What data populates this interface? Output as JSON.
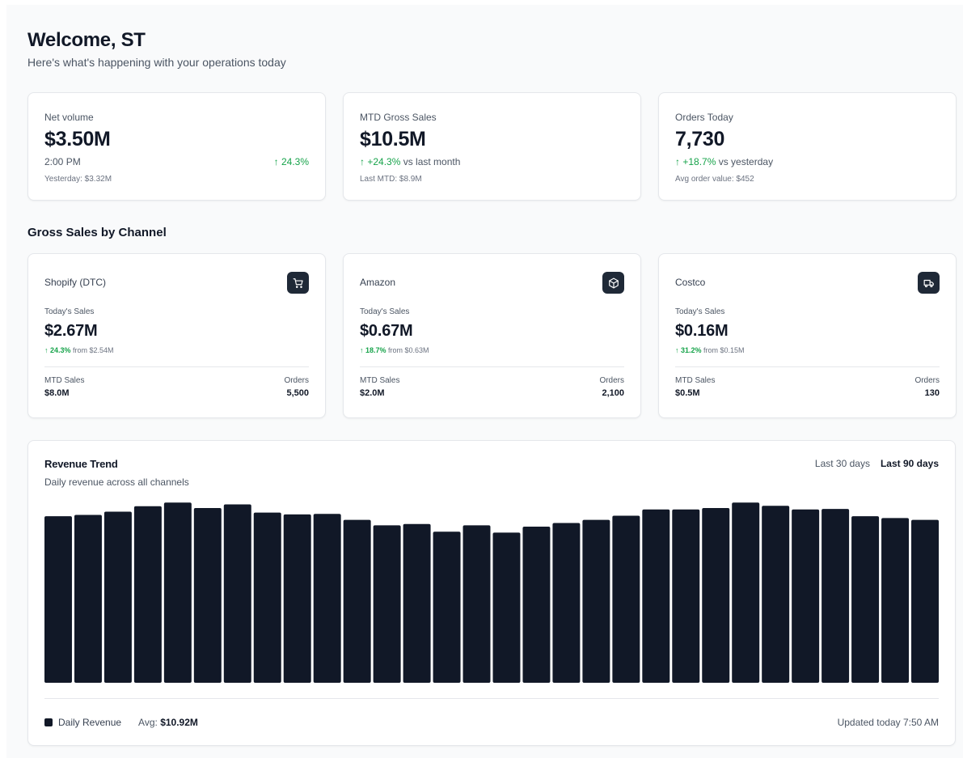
{
  "header": {
    "title": "Welcome, ST",
    "subtitle": "Here's what's happening with your operations today"
  },
  "kpis": [
    {
      "label": "Net volume",
      "value": "$3.50M",
      "meta": "2:00 PM",
      "change": "↑ 24.3%",
      "footnote": "Yesterday: $3.32M"
    },
    {
      "label": "MTD Gross Sales",
      "value": "$10.5M",
      "change": "↑ +24.3%",
      "change_suffix": " vs last month",
      "footnote": "Last MTD: $8.9M"
    },
    {
      "label": "Orders Today",
      "value": "7,730",
      "change": "↑ +18.7%",
      "change_suffix": " vs yesterday",
      "footnote": "Avg order value: $452"
    }
  ],
  "channels_section": {
    "title": "Gross Sales by Channel"
  },
  "channels": [
    {
      "name": "Shopify (DTC)",
      "icon": "shopping-cart-icon",
      "today_label": "Today's Sales",
      "today_value": "$2.67M",
      "change": "↑ 24.3%",
      "change_from": " from $2.54M",
      "mtd_label": "MTD Sales",
      "mtd_value": "$8.0M",
      "orders_label": "Orders",
      "orders_value": "5,500"
    },
    {
      "name": "Amazon",
      "icon": "package-icon",
      "today_label": "Today's Sales",
      "today_value": "$0.67M",
      "change": "↑ 18.7%",
      "change_from": " from $0.63M",
      "mtd_label": "MTD Sales",
      "mtd_value": "$2.0M",
      "orders_label": "Orders",
      "orders_value": "2,100"
    },
    {
      "name": "Costco",
      "icon": "truck-icon",
      "today_label": "Today's Sales",
      "today_value": "$0.16M",
      "change": "↑ 31.2%",
      "change_from": " from $0.15M",
      "mtd_label": "MTD Sales",
      "mtd_value": "$0.5M",
      "orders_label": "Orders",
      "orders_value": "130"
    }
  ],
  "trend": {
    "title": "Revenue Trend",
    "subtitle": "Daily revenue across all channels",
    "ranges": [
      "Last 30 days",
      "Last 90 days"
    ],
    "active_range": "Last 90 days",
    "legend_label": "Daily Revenue",
    "avg_label": "Avg: ",
    "avg_value": "$10.92M",
    "updated": "Updated today 7:50 AM"
  },
  "colors": {
    "bar": "#111827",
    "positive": "#16a34a",
    "badge": "#1f2937"
  },
  "chart_data": {
    "type": "bar",
    "series": [
      {
        "values": [
          0.915,
          0.922,
          0.94,
          0.97,
          0.99,
          0.96,
          0.98,
          0.935,
          0.925,
          0.928,
          0.895,
          0.865,
          0.872,
          0.83,
          0.865,
          0.825,
          0.858,
          0.878,
          0.895,
          0.918,
          0.952,
          0.952,
          0.96,
          0.99,
          0.972,
          0.952,
          0.955,
          0.915,
          0.905,
          0.895
        ]
      }
    ],
    "ylim": [
      0,
      1
    ],
    "grid": false,
    "legend": "bottom-left"
  }
}
